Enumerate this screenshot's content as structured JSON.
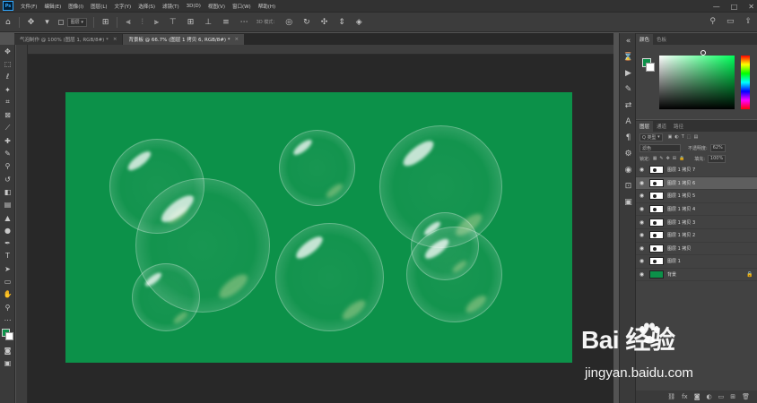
{
  "app": {
    "logo": "Ps"
  },
  "menu": [
    "文件(F)",
    "编辑(E)",
    "图像(I)",
    "图层(L)",
    "文字(Y)",
    "选择(S)",
    "滤镜(T)",
    "3D(D)",
    "视图(V)",
    "窗口(W)",
    "帮助(H)"
  ],
  "window_controls": [
    "—",
    "□",
    "✕"
  ],
  "options": {
    "auto_select_value": "图层",
    "align_label": "3D 模式："
  },
  "tabs": [
    {
      "title": "气泡制作 @ 100% (图层 1, RGB/8#) *",
      "close": "×"
    },
    {
      "title": "背景板 @ 66.7% (图层 1 拷贝 6, RGB/8#) *",
      "close": "×"
    }
  ],
  "colors": {
    "foreground": "#0c9149",
    "background": "#ffffff",
    "canvas": "#0c9149"
  },
  "panels": {
    "color_tabs": [
      "颜色",
      "色板"
    ],
    "layers_tabs": [
      "图层",
      "通道",
      "路径"
    ],
    "filter_kind": "Q 类型",
    "blend_mode": "滤色",
    "opacity_label": "不透明度:",
    "opacity_value": "62%",
    "lock_label": "锁定:",
    "fill_label": "填充:",
    "fill_value": "100%"
  },
  "layers": [
    {
      "name": "图层 1 拷贝 7",
      "active": false
    },
    {
      "name": "图层 1 拷贝 6",
      "active": true
    },
    {
      "name": "图层 1 拷贝 5",
      "active": false
    },
    {
      "name": "图层 1 拷贝 4",
      "active": false
    },
    {
      "name": "图层 1 拷贝 3",
      "active": false
    },
    {
      "name": "图层 1 拷贝 2",
      "active": false
    },
    {
      "name": "图层 1 拷贝",
      "active": false
    },
    {
      "name": "图层 1",
      "active": false
    },
    {
      "name": "背景",
      "active": false
    }
  ],
  "watermark": {
    "logo": "Bai  经验",
    "url": "jingyan.baidu.com"
  }
}
